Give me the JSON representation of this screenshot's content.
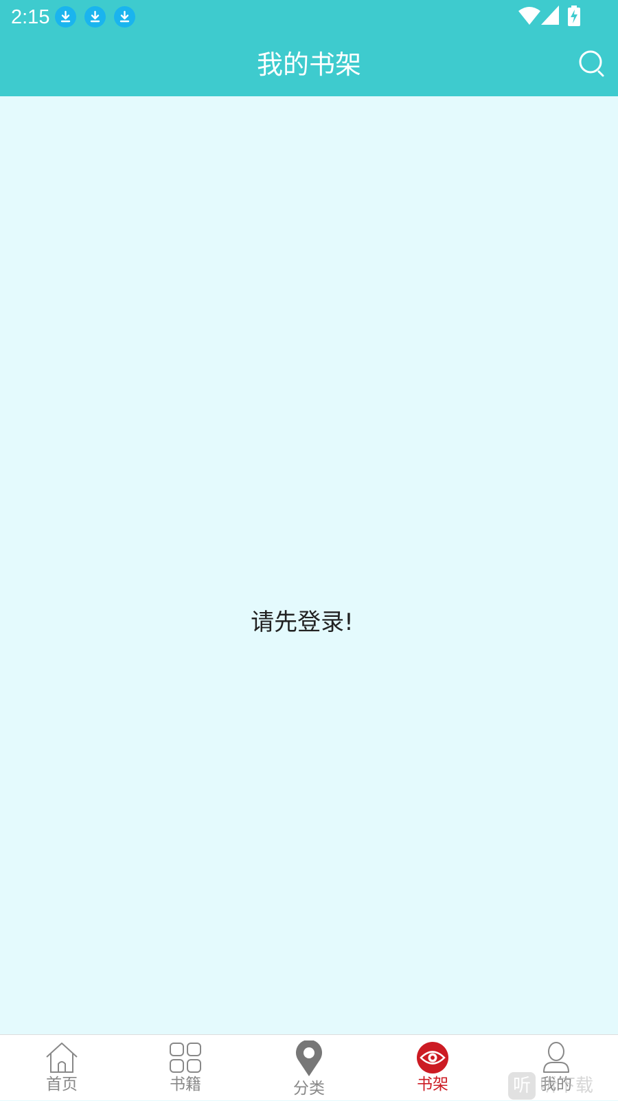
{
  "status_bar": {
    "time": "2:15",
    "notification_icons": [
      "download-icon",
      "download-icon",
      "download-icon"
    ],
    "right_icons": [
      "wifi-icon",
      "signal-icon",
      "battery-charging-icon"
    ]
  },
  "header": {
    "title": "我的书架",
    "search_icon": "search-icon"
  },
  "content": {
    "message": "请先登录!"
  },
  "tabbar": {
    "tabs": [
      {
        "label": "首页",
        "icon": "home-icon",
        "active": false
      },
      {
        "label": "书籍",
        "icon": "grid-icon",
        "active": false
      },
      {
        "label": "分类",
        "icon": "location-pin-icon",
        "active": false
      },
      {
        "label": "书架",
        "icon": "eye-icon",
        "active": true
      },
      {
        "label": "我的",
        "icon": "user-icon",
        "active": false
      }
    ]
  },
  "watermark": {
    "badge": "听",
    "text": "听下载"
  },
  "colors": {
    "header_bg": "#3ecbce",
    "content_bg": "#e4fafd",
    "active_tab": "#cc1b23",
    "inactive_tab": "#888888",
    "notification_icon": "#1ab4ee"
  }
}
